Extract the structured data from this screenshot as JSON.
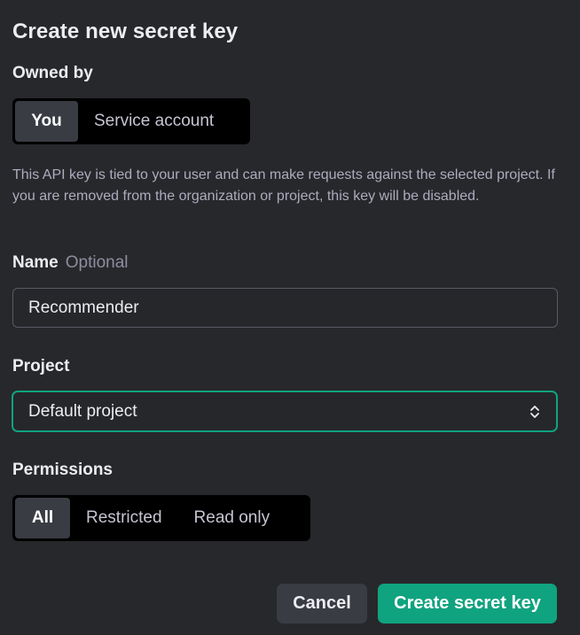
{
  "dialog": {
    "title": "Create new secret key"
  },
  "owned_by": {
    "label": "Owned by",
    "options": [
      "You",
      "Service account"
    ],
    "selected": "You",
    "description": "This API key is tied to your user and can make requests against the selected project. If you are removed from the organization or project, this key will be disabled."
  },
  "name": {
    "label": "Name",
    "optional_label": "Optional",
    "value": "Recommender"
  },
  "project": {
    "label": "Project",
    "selected": "Default project",
    "icon": "chevron-up-down-icon"
  },
  "permissions": {
    "label": "Permissions",
    "options": [
      "All",
      "Restricted",
      "Read only"
    ],
    "selected": "All"
  },
  "actions": {
    "cancel_label": "Cancel",
    "create_label": "Create secret key"
  },
  "colors": {
    "background": "#27282c",
    "accent": "#10a37f",
    "segmented_bg": "#000000",
    "active_segment": "#3a3c44"
  }
}
